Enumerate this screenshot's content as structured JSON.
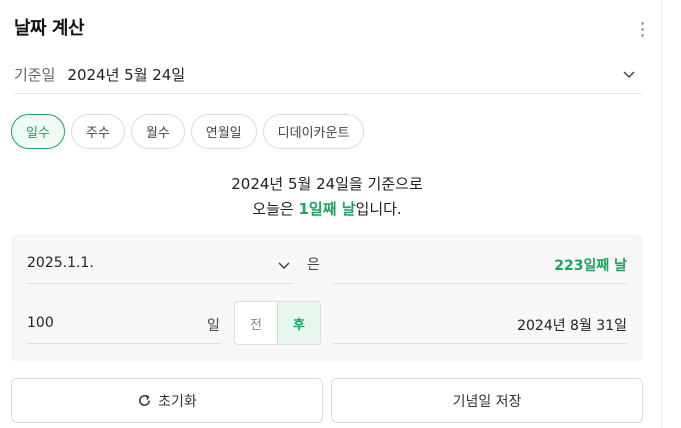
{
  "header": {
    "title": "날짜 계산"
  },
  "base": {
    "label": "기준일",
    "value": "2024년 5월 24일"
  },
  "tabs": [
    {
      "label": "일수",
      "active": true
    },
    {
      "label": "주수",
      "active": false
    },
    {
      "label": "월수",
      "active": false
    },
    {
      "label": "연월일",
      "active": false
    },
    {
      "label": "디데이카운트",
      "active": false
    }
  ],
  "summary": {
    "line1": "2024년 5월 24일을 기준으로",
    "line2_prefix": "오늘은 ",
    "line2_highlight": "1일째 날",
    "line2_suffix": "입니다."
  },
  "calc": {
    "date_value": "2025.1.1.",
    "particle": "은",
    "result_days": "223일째 날",
    "number_value": "100",
    "unit": "일",
    "before_label": "전",
    "after_label": "후",
    "selected": "후",
    "result_date": "2024년 8월 31일"
  },
  "buttons": {
    "reset": "초기화",
    "save": "기념일 저장"
  },
  "colors": {
    "accent": "#1ea362"
  }
}
